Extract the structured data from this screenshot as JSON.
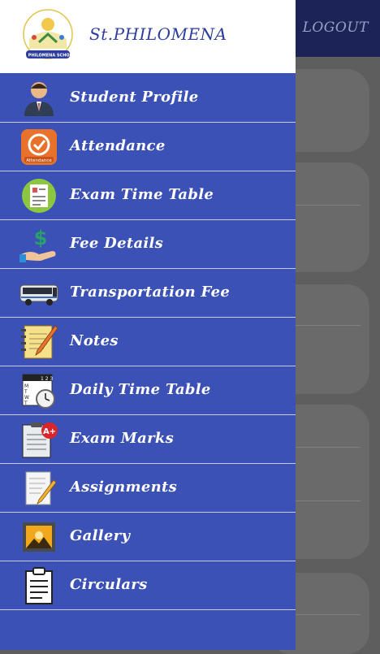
{
  "app": {
    "school_name": "St.PHILOMENA",
    "logo_text": "ST. PHILOMENA SCHOOL",
    "logo_motto": "RESPECT • RESPONSIBILITY • EXCELLENCE",
    "logout_label": "LOGOUT"
  },
  "menu": [
    {
      "label": "Student Profile",
      "icon": "student-profile-icon"
    },
    {
      "label": "Attendance",
      "icon": "attendance-icon"
    },
    {
      "label": "Exam Time Table",
      "icon": "exam-timetable-icon"
    },
    {
      "label": "Fee Details",
      "icon": "fee-details-icon"
    },
    {
      "label": "Transportation Fee",
      "icon": "bus-icon"
    },
    {
      "label": "Notes",
      "icon": "notes-icon"
    },
    {
      "label": "Daily Time Table",
      "icon": "daily-timetable-icon"
    },
    {
      "label": "Exam Marks",
      "icon": "exam-marks-icon"
    },
    {
      "label": "Assignments",
      "icon": "assignments-icon"
    },
    {
      "label": "Gallery",
      "icon": "gallery-icon"
    },
    {
      "label": "Circulars",
      "icon": "circulars-icon"
    }
  ],
  "colors": {
    "drawer_bg": "#3b51b5",
    "header_bg": "#ffffff",
    "brand_text": "#2d3d9c",
    "topbar": "#1c2457"
  }
}
